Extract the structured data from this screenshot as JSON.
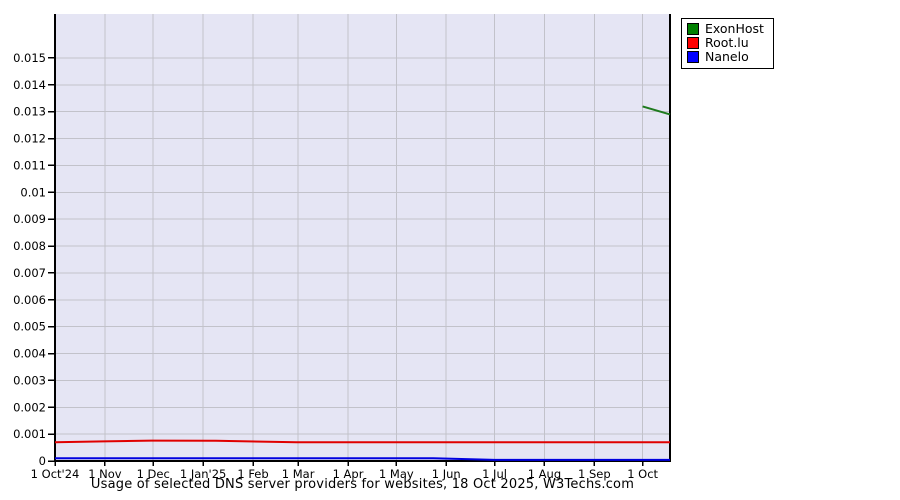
{
  "legend": {
    "items": [
      {
        "label": "ExonHost",
        "swatch_color": "#008000"
      },
      {
        "label": "Root.lu",
        "swatch_color": "#ff0000"
      },
      {
        "label": "Nanelo",
        "swatch_color": "#0000ff"
      }
    ]
  },
  "chart_data": {
    "type": "line",
    "title": "Usage of selected DNS server providers for websites, 18 Oct 2025, W3Techs.com",
    "xlabel": "",
    "ylabel": "",
    "ylim": [
      0,
      0.0158
    ],
    "x_axis_total_days": 382,
    "grid": true,
    "legend_position": "outside-top-right",
    "plot_bg_color": "#e5e5f4",
    "grid_color": "#c2c2ca",
    "axis_color": "#000000",
    "y_ticks": [
      {
        "value": 0,
        "label": "0"
      },
      {
        "value": 0.001,
        "label": "0.001"
      },
      {
        "value": 0.002,
        "label": "0.002"
      },
      {
        "value": 0.003,
        "label": "0.003"
      },
      {
        "value": 0.004,
        "label": "0.004"
      },
      {
        "value": 0.005,
        "label": "0.005"
      },
      {
        "value": 0.006,
        "label": "0.006"
      },
      {
        "value": 0.007,
        "label": "0.007"
      },
      {
        "value": 0.008,
        "label": "0.008"
      },
      {
        "value": 0.009,
        "label": "0.009"
      },
      {
        "value": 0.01,
        "label": "0.01"
      },
      {
        "value": 0.011,
        "label": "0.011"
      },
      {
        "value": 0.012,
        "label": "0.012"
      },
      {
        "value": 0.013,
        "label": "0.013"
      },
      {
        "value": 0.014,
        "label": "0.014"
      },
      {
        "value": 0.015,
        "label": "0.015"
      }
    ],
    "x_ticks": [
      {
        "day": 0,
        "label": "1 Oct'24"
      },
      {
        "day": 31,
        "label": "1 Nov"
      },
      {
        "day": 61,
        "label": "1 Dec"
      },
      {
        "day": 92,
        "label": "1 Jan'25"
      },
      {
        "day": 123,
        "label": "1 Feb"
      },
      {
        "day": 151,
        "label": "1 Mar"
      },
      {
        "day": 182,
        "label": "1 Apr"
      },
      {
        "day": 212,
        "label": "1 May"
      },
      {
        "day": 243,
        "label": "1 Jun"
      },
      {
        "day": 273,
        "label": "1 Jul"
      },
      {
        "day": 304,
        "label": "1 Aug"
      },
      {
        "day": 335,
        "label": "1 Sep"
      },
      {
        "day": 365,
        "label": "1 Oct"
      }
    ],
    "series": [
      {
        "name": "ExonHost",
        "color": "#1e7a1e",
        "points": [
          [
            365,
            0.0132
          ],
          [
            382,
            0.0129
          ]
        ]
      },
      {
        "name": "Root.lu",
        "color": "#e00000",
        "points": [
          [
            0,
            0.0007
          ],
          [
            30,
            0.00073
          ],
          [
            60,
            0.00076
          ],
          [
            100,
            0.00075
          ],
          [
            150,
            0.0007
          ],
          [
            382,
            0.0007
          ]
        ]
      },
      {
        "name": "Nanelo",
        "color": "#0000e0",
        "points": [
          [
            0,
            0.0001
          ],
          [
            235,
            0.0001
          ],
          [
            273,
            4e-05
          ],
          [
            382,
            4e-05
          ]
        ]
      }
    ]
  }
}
